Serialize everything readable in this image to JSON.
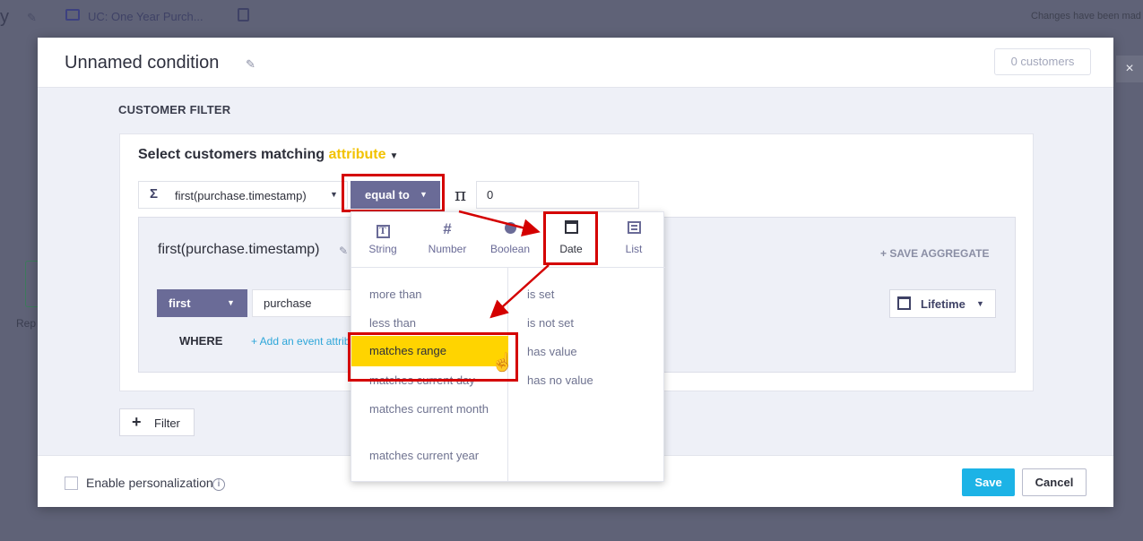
{
  "background": {
    "title_fragment": "y",
    "folder_title": "UC: One Year Purch...",
    "changes_text": "Changes have been mad",
    "side_label": "Rep",
    "close_glyph": "×"
  },
  "modal": {
    "title": "Unnamed condition",
    "customers_count": "0 customers"
  },
  "filter": {
    "section_title": "CUSTOMER FILTER",
    "select_prefix": "Select customers matching",
    "select_mode": "attribute",
    "aggregate_field": "first(purchase.timestamp)",
    "operator": "equal to",
    "value_type_glyph": "π",
    "value": "0",
    "aggregate": {
      "title": "first(purchase.timestamp)",
      "save_label": "+ SAVE AGGREGATE",
      "function": "first",
      "event": "purchase",
      "where_label": "WHERE",
      "add_attribute": "+ Add an event attribute",
      "time_range": "Lifetime"
    },
    "add_filter_label": "Filter"
  },
  "dropdown": {
    "types": [
      {
        "label": "String",
        "icon": "string-type-icon"
      },
      {
        "label": "Number",
        "icon": "hash-icon"
      },
      {
        "label": "Boolean",
        "icon": "boolean-dot-icon"
      },
      {
        "label": "Date",
        "icon": "calendar-icon"
      },
      {
        "label": "List",
        "icon": "list-icon"
      }
    ],
    "active_type": "Date",
    "left_ops": [
      "more than",
      "less than",
      "matches range",
      "matches current day",
      "matches current month",
      "matches current year"
    ],
    "right_ops": [
      "is set",
      "is not set",
      "has value",
      "has no value"
    ],
    "selected_op": "matches range"
  },
  "footer": {
    "personalization_label": "Enable personalization",
    "save_label": "Save",
    "cancel_label": "Cancel"
  },
  "colors": {
    "accent_purple": "#6a6b97",
    "highlight_yellow": "#ffd400",
    "annotation_red": "#d40000",
    "save_blue": "#1cb3e6",
    "attribute_yellow": "#f2c200"
  }
}
